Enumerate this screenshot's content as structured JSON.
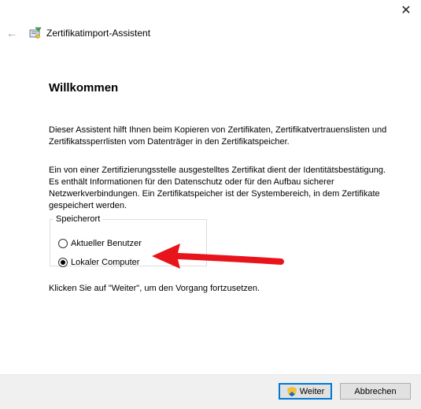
{
  "window": {
    "title": "Zertifikatimport-Assistent",
    "close_glyph": "✕",
    "back_glyph": "←"
  },
  "content": {
    "heading": "Willkommen",
    "intro": "Dieser Assistent hilft Ihnen beim Kopieren von Zertifikaten, Zertifikatvertrauenslisten und Zertifikatssperrlisten vom Datenträger in den Zertifikatspeicher.",
    "info": "Ein von einer Zertifizierungsstelle ausgestelltes Zertifikat dient der Identitätsbestätigung. Es enthält Informationen für den Datenschutz oder für den Aufbau sicherer Netzwerkverbindungen. Ein Zertifikatspeicher ist der Systembereich, in dem Zertifikate gespeichert werden.",
    "storage": {
      "legend": "Speicherort",
      "options": [
        {
          "label": "Aktueller Benutzer",
          "selected": false
        },
        {
          "label": "Lokaler Computer",
          "selected": true
        }
      ]
    },
    "continue_hint": "Klicken Sie auf \"Weiter\", um den Vorgang fortzusetzen."
  },
  "footer": {
    "next_label": "Weiter",
    "cancel_label": "Abbrechen"
  },
  "icons": {
    "titlebar": "certificate-icon",
    "next_button": "uac-shield-icon",
    "annotation": "red-arrow-icon"
  },
  "colors": {
    "accent": "#0078d7",
    "annotation": "#e8141c",
    "footer_bg": "#f0f0f0"
  }
}
